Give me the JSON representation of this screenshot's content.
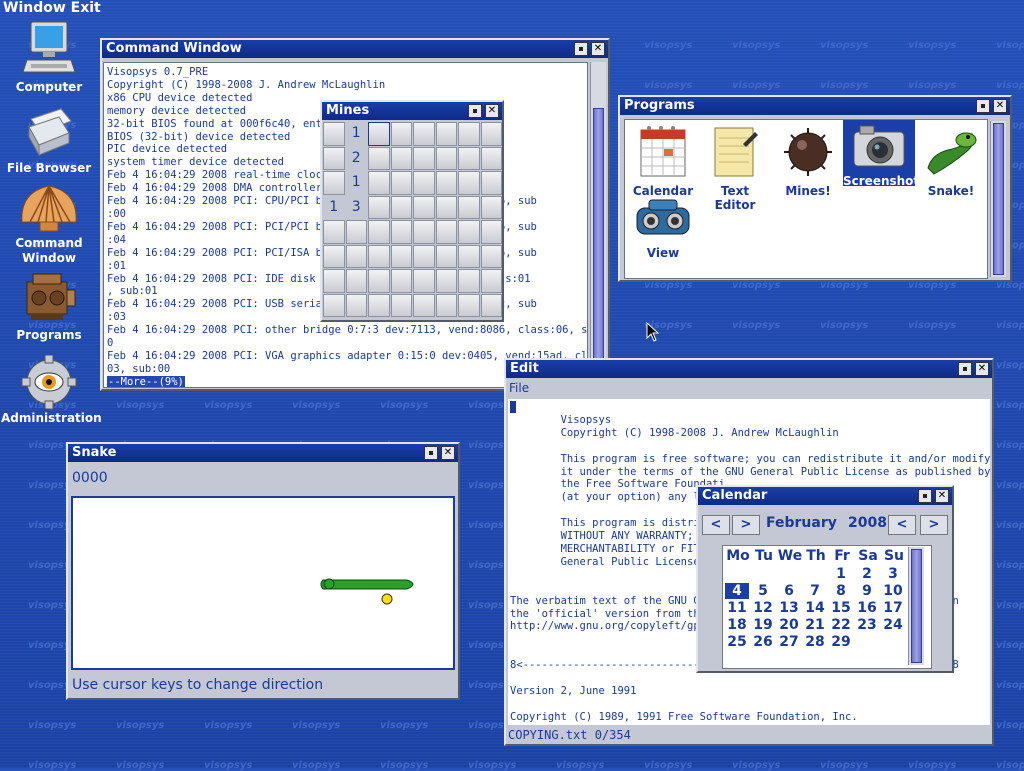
{
  "desktop": {
    "title": "Window Exit",
    "icons": [
      {
        "label": "Computer"
      },
      {
        "label": "File Browser"
      },
      {
        "label": "Command Window"
      },
      {
        "label": "Programs"
      },
      {
        "label": "Administration"
      }
    ],
    "watermark": "visopsys"
  },
  "command_window": {
    "title": "Command Window",
    "lines": [
      "Visopsys 0.7_PRE",
      "Copyright (C) 1998-2008 J. Andrew McLaughlin",
      "x86 CPU device detected",
      "memory device detected",
      "32-bit BIOS found at 000f6c40, entry",
      "BIOS (32-bit) device detected",
      "PIC device detected",
      "system timer device detected",
      "Feb 4 16:04:29 2008 real-time clock",
      "Feb 4 16:04:29 2008 DMA controller d",
      "Feb 4 16:04:29 2008 PCI: CPU/PCI bri                   class:06, sub",
      ":00",
      "Feb 4 16:04:29 2008 PCI: PCI/PCI bri                   class:06, sub",
      ":04",
      "Feb 4 16:04:29 2008 PCI: PCI/ISA bri                   class:06, sub",
      ":01",
      "Feb 4 16:04:29 2008 PCI: IDE disk co                 8086, class:01",
      ", sub:01",
      "Feb 4 16:04:29 2008 PCI: USB serial                    class:0c, sub",
      ":03",
      "Feb 4 16:04:29 2008 PCI: other bridge 0:7:3 dev:7113, vend:8086, class:06, sub:8",
      "0",
      "Feb 4 16:04:29 2008 PCI: VGA graphics adapter 0:15:0 dev:0405, vend:15ad, class:",
      "03, sub:00"
    ],
    "more": "--More--(9%)"
  },
  "mines": {
    "title": "Mines",
    "numbers": [
      {
        "row": 0,
        "col": 1,
        "value": "1"
      },
      {
        "row": 1,
        "col": 1,
        "value": "2"
      },
      {
        "row": 2,
        "col": 1,
        "value": "1"
      },
      {
        "row": 3,
        "col": 0,
        "value": "1"
      },
      {
        "row": 3,
        "col": 1,
        "value": "3"
      }
    ]
  },
  "programs": {
    "title": "Programs",
    "items": [
      {
        "label": "Calendar"
      },
      {
        "label": "Text Editor"
      },
      {
        "label": "Mines!"
      },
      {
        "label": "Screenshot",
        "selected": true
      },
      {
        "label": "Snake!"
      },
      {
        "label": "View"
      }
    ]
  },
  "snake": {
    "title": "Snake",
    "score": "0000",
    "hint": "Use cursor keys to change direction"
  },
  "edit": {
    "title": "Edit",
    "menu": "File",
    "lines": [
      "",
      "        Visopsys",
      "        Copyright (C) 1998-2008 J. Andrew McLaughlin",
      "",
      "        This program is free software; you can redistribute it and/or modify",
      "        it under the terms of the GNU General Public License as published by",
      "        the Free Software Foundati",
      "        (at your option) any la",
      "",
      "        This program is distrib",
      "        WITHOUT ANY WARRANTY; w",
      "        MERCHANTABILITY or FITN",
      "        General Public License",
      "",
      "",
      "The verbatim text of the GNU Ge                                      in",
      "the 'official' version from the",
      "http://www.gnu.org/copyleft/gpl",
      "",
      "",
      "8<-------------------------------                                   ->8",
      "",
      "Version 2, June 1991",
      "",
      "Copyright (C) 1989, 1991 Free Software Foundation, Inc."
    ],
    "status": "COPYING.txt 0/354"
  },
  "calendar": {
    "title": "Calendar",
    "prev": "<",
    "next": ">",
    "month": "February",
    "year": "2008",
    "weekdays": [
      "Mo",
      "Tu",
      "We",
      "Th",
      "Fr",
      "Sa",
      "Su"
    ],
    "weeks": [
      [
        "",
        "",
        "",
        "",
        "1",
        "2",
        "3"
      ],
      [
        "4",
        "5",
        "6",
        "7",
        "8",
        "9",
        "10"
      ],
      [
        "11",
        "12",
        "13",
        "14",
        "15",
        "16",
        "17"
      ],
      [
        "18",
        "19",
        "20",
        "21",
        "22",
        "23",
        "24"
      ],
      [
        "25",
        "26",
        "27",
        "28",
        "29",
        "",
        ""
      ]
    ],
    "today": "4"
  },
  "colors": {
    "desktop": "#1f48b0",
    "titlebar": "#0d2a86",
    "text_blue": "#1a3a9a",
    "window_bg": "#c4c8d4"
  }
}
